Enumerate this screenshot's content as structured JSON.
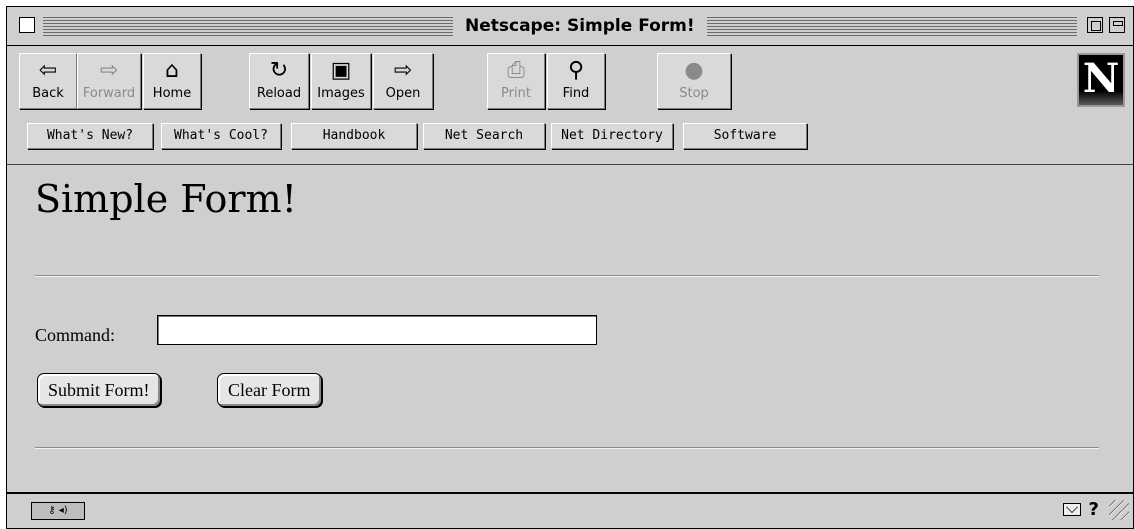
{
  "window": {
    "title": "Netscape: Simple Form!"
  },
  "toolbar": {
    "buttons": [
      {
        "label": "Back",
        "icon": "back-arrow-icon",
        "glyph": "⇦",
        "enabled": true
      },
      {
        "label": "Forward",
        "icon": "forward-arrow-icon",
        "glyph": "⇨",
        "enabled": false
      },
      {
        "label": "Home",
        "icon": "home-icon",
        "glyph": "⌂",
        "enabled": true
      },
      {
        "label": "Reload",
        "icon": "reload-icon",
        "glyph": "↻",
        "enabled": true
      },
      {
        "label": "Images",
        "icon": "images-icon",
        "glyph": "▣",
        "enabled": true
      },
      {
        "label": "Open",
        "icon": "open-icon",
        "glyph": "⇨",
        "enabled": true
      },
      {
        "label": "Print",
        "icon": "print-icon",
        "glyph": "⎙",
        "enabled": false
      },
      {
        "label": "Find",
        "icon": "find-binoculars-icon",
        "glyph": "⚲",
        "enabled": true
      },
      {
        "label": "Stop",
        "icon": "stop-icon",
        "glyph": "●",
        "enabled": false
      }
    ],
    "directory": [
      "What's New?",
      "What's Cool?",
      "Handbook",
      "Net Search",
      "Net Directory",
      "Software"
    ],
    "logo": "N"
  },
  "page": {
    "heading": "Simple Form!",
    "command_label": "Command:",
    "command_value": "",
    "submit_label": "Submit Form!",
    "clear_label": "Clear Form"
  },
  "status": {
    "security_icon": "security-key-icon",
    "help": "?"
  }
}
